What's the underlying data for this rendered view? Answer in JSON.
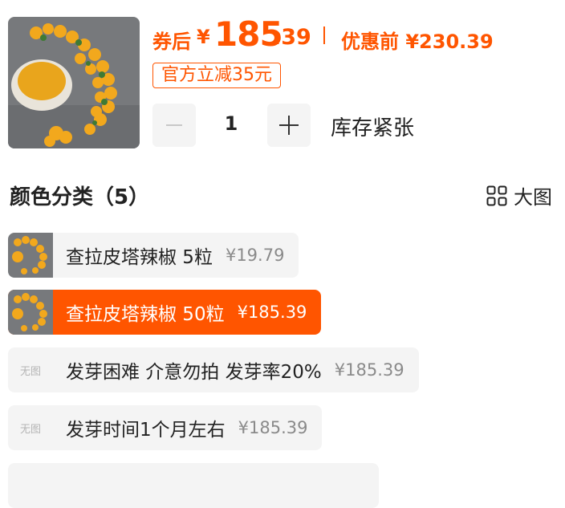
{
  "price": {
    "after_label": "券后",
    "yen": "¥",
    "after_int": "185",
    "after_dec": ".39",
    "before_label": "优惠前 ¥230.39"
  },
  "promo_tag": "官方立减35元",
  "quantity": {
    "minus": "—",
    "value": "1",
    "plus": "+",
    "stock_status": "库存紧张"
  },
  "section": {
    "title": "颜色分类（5）",
    "big_view_label": "大图"
  },
  "options": [
    {
      "thumb": "image",
      "name": "查拉皮塔辣椒 5粒",
      "price": "¥19.79",
      "selected": false
    },
    {
      "thumb": "image",
      "name": "查拉皮塔辣椒 50粒",
      "price": "¥185.39",
      "selected": true
    },
    {
      "thumb_text": "无图",
      "name": "发芽困难 介意勿拍 发芽率20%",
      "price": "¥185.39",
      "selected": false
    },
    {
      "thumb_text": "无图",
      "name": "发芽时间1个月左右",
      "price": "¥185.39",
      "selected": false
    }
  ],
  "colors": {
    "accent": "#ff5500",
    "chip_bg": "#f4f4f4"
  }
}
